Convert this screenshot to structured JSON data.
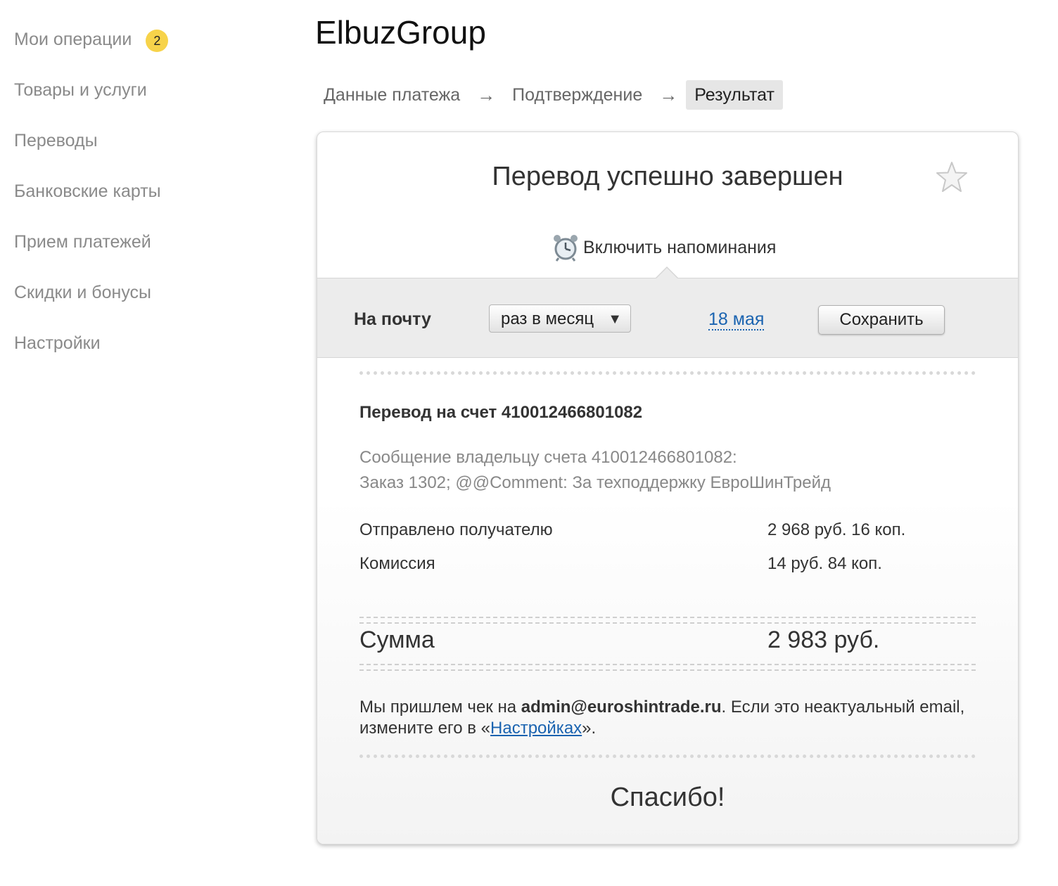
{
  "sidebar": {
    "items": [
      {
        "label": "Мои операции",
        "badge": "2"
      },
      {
        "label": "Товары и услуги"
      },
      {
        "label": "Переводы"
      },
      {
        "label": "Банковские карты"
      },
      {
        "label": "Прием платежей"
      },
      {
        "label": "Скидки и бонусы"
      },
      {
        "label": "Настройки"
      }
    ]
  },
  "header": {
    "brand": "ElbuzGroup"
  },
  "steps": {
    "items": [
      "Данные платежа",
      "Подтверждение",
      "Результат"
    ],
    "arrow": "→",
    "active": "Результат"
  },
  "card": {
    "title": "Перевод успешно завершен",
    "reminder_label": "Включить напоминания",
    "settings": {
      "to_mail": "На почту",
      "frequency": "раз в месяц",
      "frequency_caret": "▼",
      "date": "18 мая",
      "save": "Сохранить"
    },
    "account_title": "Перевод на счет 410012466801082",
    "message_line1": "Сообщение владельцу счета 410012466801082:",
    "message_line2": "Заказ 1302; @@Comment: За техподдержку ЕвроШинТрейд",
    "rows": [
      {
        "name": "Отправлено получателю",
        "value": "2 968 руб. 16 коп."
      },
      {
        "name": "Комиссия",
        "value": "14 руб. 84 коп."
      }
    ],
    "total": {
      "name": "Сумма",
      "value": "2 983 руб."
    },
    "receipt": {
      "prefix": "Мы пришлем чек на ",
      "email": "admin@euroshintrade.ru",
      "middle": ". Если это неактуальный email, измените его в «",
      "link": "Настройках",
      "suffix": "»."
    },
    "thanks": "Спасибо!"
  },
  "colors": {
    "accent_link": "#1a63b0",
    "badge": "#f7d34a",
    "active_step_bg": "#e6e6e6"
  },
  "icons": {
    "reminder": "alarm-clock-icon",
    "favorite": "star-icon",
    "dropdown": "caret-down-icon"
  }
}
